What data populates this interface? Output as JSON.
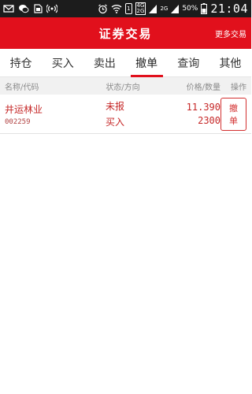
{
  "status_bar": {
    "battery_percent": "50%",
    "time": "21:04",
    "sim_label": "1",
    "net_top": "4G",
    "net_bottom": "2G",
    "net2": "2G"
  },
  "header": {
    "title": "证券交易",
    "more_label": "更多交易"
  },
  "tabs": [
    {
      "label": "持仓"
    },
    {
      "label": "买入"
    },
    {
      "label": "卖出"
    },
    {
      "label": "撤单",
      "active": true
    },
    {
      "label": "查询"
    },
    {
      "label": "其他"
    }
  ],
  "table": {
    "headers": [
      "名称/代码",
      "状态/方向",
      "价格/数量",
      "操作"
    ],
    "rows": [
      {
        "name": "井运林业",
        "code": "002259",
        "status": "未报",
        "direction": "买入",
        "price": "11.390",
        "quantity": "2300",
        "action": "撤单"
      }
    ]
  },
  "colors": {
    "accent": "#e1101c",
    "text_red": "#c62828",
    "header_bg": "#f1f1f1"
  }
}
